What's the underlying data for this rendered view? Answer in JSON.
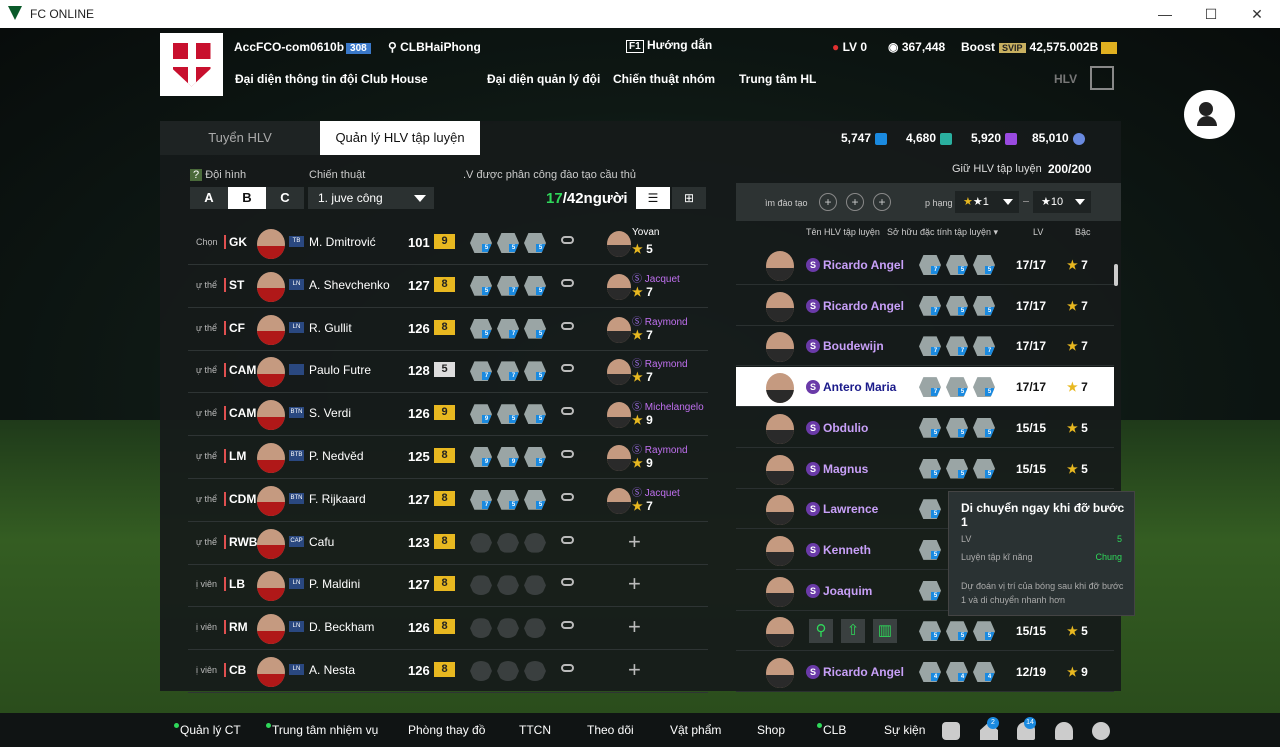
{
  "window": {
    "title": "FC ONLINE",
    "min": "—",
    "max": "☐",
    "close": "✕"
  },
  "header": {
    "account": "AccFCO-com0610b",
    "level_badge": "308",
    "club": "CLBHaiPhong",
    "guide_key": "F1",
    "guide": "Hướng dẫn",
    "lv": "LV 0",
    "coins": "367,448",
    "boost": "Boost",
    "svip": "SVIP",
    "bp": "42,575.002B",
    "nav": [
      "Đại diện thông tin đội",
      "Club House",
      "Đại diện quản lý đội",
      "Chiến thuật nhóm",
      "Trung tâm HL"
    ],
    "hlv": "HLV"
  },
  "tabs": [
    "Tuyển HLV",
    "Quản lý HLV tập luyện"
  ],
  "currencies": [
    {
      "value": "5,747",
      "color": "#1a8ae0"
    },
    {
      "value": "4,680",
      "color": "#2ab0a0"
    },
    {
      "value": "5,920",
      "color": "#9a4ae0"
    },
    {
      "value": "85,010",
      "color": "#6a8ae0"
    }
  ],
  "left": {
    "formation_label": "Đội hình",
    "q": "?",
    "formations": [
      "A",
      "B",
      "C"
    ],
    "tactic_label": "Chiến thuật",
    "tactic_value": "1. juve công",
    "assign_label": ".V được phân công đào tạo cầu thủ",
    "assigned": "17",
    "total": "/42người"
  },
  "players": [
    {
      "p1": "Chọn",
      "pos": "GK",
      "season": "TB",
      "name": "M. Dmitrović",
      "ovr": "101",
      "lvl": "9",
      "coach": "Yovan",
      "stars": "5",
      "cw": true,
      "icons": [
        "5",
        "5",
        "5"
      ]
    },
    {
      "p1": "ự thể",
      "pos": "ST",
      "season": "LN",
      "name": "A. Shevchenko",
      "ovr": "127",
      "lvl": "8",
      "coach": "Jacquet",
      "stars": "7",
      "icons": [
        "5",
        "7",
        "5"
      ]
    },
    {
      "p1": "ự thể",
      "pos": "CF",
      "season": "LN",
      "name": "R. Gullit",
      "ovr": "126",
      "lvl": "8",
      "coach": "Raymond",
      "stars": "7",
      "icons": [
        "5",
        "7",
        "5"
      ]
    },
    {
      "p1": "ự thể",
      "pos": "CAM",
      "season": "",
      "name": "Paulo Futre",
      "ovr": "128",
      "lvl": "5",
      "lw": true,
      "coach": "Raymond",
      "stars": "7",
      "icons": [
        "7",
        "7",
        "5"
      ]
    },
    {
      "p1": "ự thể",
      "pos": "CAM",
      "season": "BTN",
      "name": "S. Verdi",
      "ovr": "126",
      "lvl": "9",
      "coach": "Michelangelo",
      "stars": "9",
      "icons": [
        "9",
        "5",
        "5"
      ]
    },
    {
      "p1": "ự thể",
      "pos": "LM",
      "season": "BTB",
      "name": "P. Nedvěd",
      "ovr": "125",
      "lvl": "8",
      "coach": "Raymond",
      "stars": "9",
      "icons": [
        "9",
        "9",
        "5"
      ]
    },
    {
      "p1": "ự thể",
      "pos": "CDM",
      "season": "BTN",
      "name": "F. Rijkaard",
      "ovr": "127",
      "lvl": "8",
      "coach": "Jacquet",
      "stars": "7",
      "icons": [
        "7",
        "5",
        "5"
      ]
    },
    {
      "p1": "ự thể",
      "pos": "RWB",
      "season": "CAP",
      "name": "Cafu",
      "ovr": "123",
      "lvl": "8",
      "empty": true
    },
    {
      "p1": "ị viên",
      "pos": "LB",
      "season": "LN",
      "name": "P. Maldini",
      "ovr": "127",
      "lvl": "8",
      "empty": true
    },
    {
      "p1": "ị viên",
      "pos": "RM",
      "season": "LN",
      "name": "D. Beckham",
      "ovr": "126",
      "lvl": "8",
      "empty": true
    },
    {
      "p1": "ị viên",
      "pos": "CB",
      "season": "LN",
      "name": "A. Nesta",
      "ovr": "126",
      "lvl": "8",
      "empty": true
    }
  ],
  "right": {
    "keep_label": "Giữ HLV tập luyện",
    "keep_value": "200/200",
    "find_label": "ìm đào tạo",
    "grade_label": "p hạng",
    "star_from": "★1",
    "star_to": "★10",
    "col_name": "Tên HLV tập luyện",
    "col_skill": "Sở hữu đặc tính tập luyện ▾",
    "col_lv": "LV",
    "col_grade": "Bậc"
  },
  "coaches": [
    {
      "name": "Ricardo Angel",
      "lv": "17/17",
      "grade": "7",
      "icons": [
        "7",
        "5",
        "5"
      ]
    },
    {
      "name": "Ricardo Angel",
      "lv": "17/17",
      "grade": "7",
      "icons": [
        "7",
        "5",
        "5"
      ]
    },
    {
      "name": "Boudewijn",
      "lv": "17/17",
      "grade": "7",
      "icons": [
        "7",
        "7",
        "7"
      ]
    },
    {
      "name": "Antero Maria",
      "lv": "17/17",
      "grade": "7",
      "icons": [
        "7",
        "5",
        "5"
      ],
      "hl": true
    },
    {
      "name": "Obdulio",
      "lv": "15/15",
      "grade": "5",
      "icons": [
        "5",
        "5",
        "5"
      ]
    },
    {
      "name": "Magnus",
      "lv": "15/15",
      "grade": "5",
      "icons": [
        "5",
        "5",
        "5"
      ]
    },
    {
      "name": "Lawrence",
      "lv": "",
      "grade": "",
      "icons": [
        "5"
      ]
    },
    {
      "name": "Kenneth",
      "lv": "",
      "grade": "",
      "icons": [
        "5"
      ]
    },
    {
      "name": "Joaquim",
      "lv": "",
      "grade": "",
      "icons": [
        "5"
      ]
    },
    {
      "name": "",
      "lv": "15/15",
      "grade": "5",
      "icons": [
        "5",
        "5",
        "5"
      ],
      "actions": true
    },
    {
      "name": "Ricardo Angel",
      "lv": "12/19",
      "grade": "9",
      "icons": [
        "4",
        "4",
        "4"
      ]
    }
  ],
  "tooltip": {
    "title": "Di chuyển ngay khi đỡ bước 1",
    "lv_label": "LV",
    "lv_value": "5",
    "skill_label": "Luyện tập kĩ năng",
    "skill_value": "Chung",
    "desc": "Dự đoán vị trí của bóng sau khi đỡ bước 1 và di chuyển nhanh hơn"
  },
  "footer": [
    "Quản lý CT",
    "Trung tâm nhiệm vụ",
    "Phòng thay đồ",
    "TTCN",
    "Theo dõi",
    "Vật phẩm",
    "Shop",
    "CLB",
    "Sự kiện"
  ],
  "footer_badges": {
    "home": "2",
    "bell": "14"
  }
}
